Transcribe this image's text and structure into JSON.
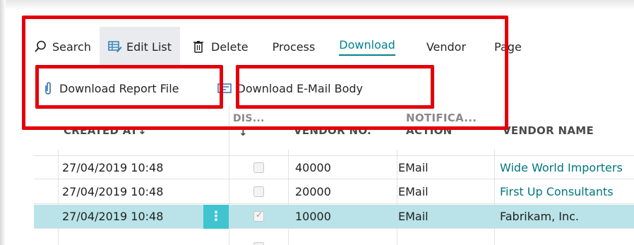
{
  "actionbar": {
    "search": "Search",
    "edit_list": "Edit List",
    "delete": "Delete",
    "process": "Process",
    "download": "Download",
    "vendor": "Vendor",
    "page": "Page"
  },
  "subactions": {
    "download_report_file": "Download Report File",
    "download_email_body": "Download E-Mail Body"
  },
  "table": {
    "headers": {
      "created_at": "CREATED AT↓",
      "dis": "DIS...",
      "dis_sort": "↓",
      "vendor_no": "VENDOR NO.",
      "notification_line1": "NOTIFICA...",
      "notification_line2": "ACTION",
      "vendor_name": "VENDOR NAME"
    },
    "rows": [
      {
        "created_at": "27/04/2019 10:48",
        "vendor_no": "40000",
        "action": "EMail",
        "vendor_name": "Wide World Importers",
        "disabled": false,
        "selected": false
      },
      {
        "created_at": "27/04/2019 10:48",
        "vendor_no": "20000",
        "action": "EMail",
        "vendor_name": "First Up Consultants",
        "disabled": false,
        "selected": false
      },
      {
        "created_at": "27/04/2019 10:48",
        "vendor_no": "10000",
        "action": "EMail",
        "vendor_name": "Fabrikam, Inc.",
        "disabled": true,
        "selected": true
      }
    ],
    "row_menu": "⋮"
  },
  "colors": {
    "accent": "#00838f",
    "selection": "#b9e3e8",
    "highlight_box": "#e3000b"
  }
}
